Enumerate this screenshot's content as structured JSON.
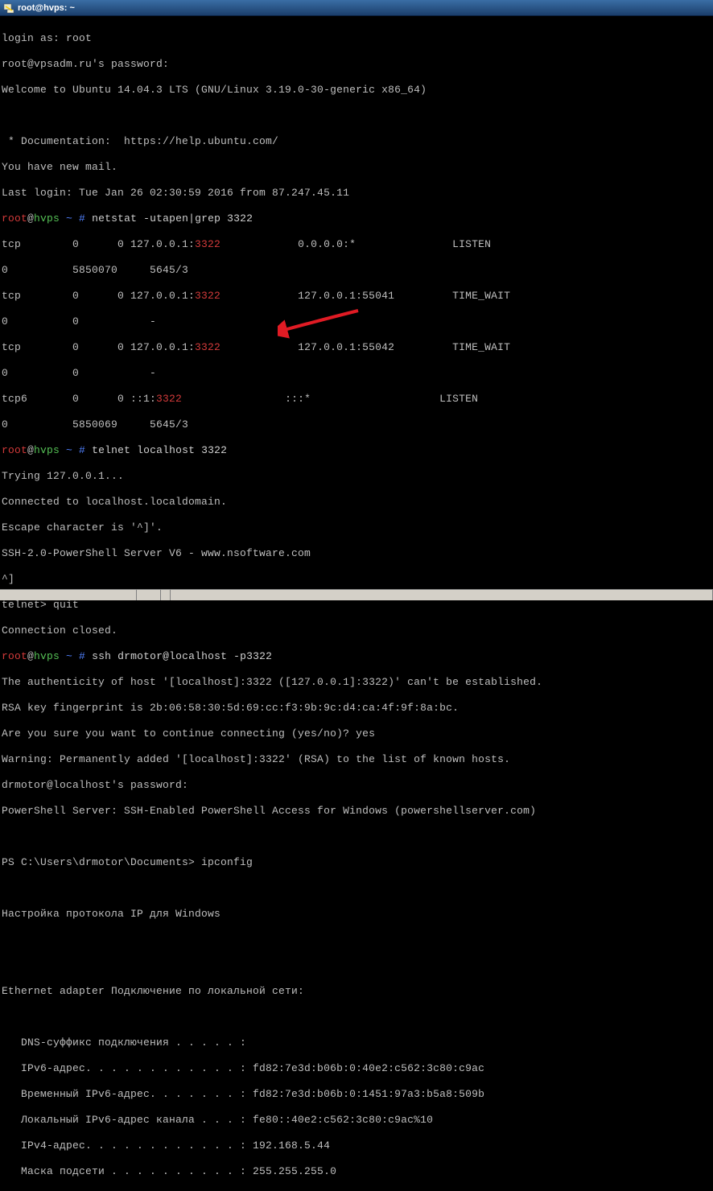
{
  "window": {
    "title": "root@hvps: ~",
    "icon_name": "putty-icon"
  },
  "prompt": {
    "user": "root",
    "at": "@",
    "host": "hvps",
    "path_sep": " ~ # "
  },
  "lines": {
    "login_as": "login as: root",
    "password_prompt": "root@vpsadm.ru's password:",
    "welcome": "Welcome to Ubuntu 14.04.3 LTS (GNU/Linux 3.19.0-30-generic x86_64)",
    "blank": "",
    "docs": " * Documentation:  https://help.ubuntu.com/",
    "mail": "You have new mail.",
    "last_login": "Last login: Tue Jan 26 02:30:59 2016 from 87.247.45.11",
    "cmd_netstat": "netstat -utapen|grep 3322",
    "ns_r1_a": "tcp        0      0 127.0.0.1:",
    "ns_r1_port": "3322",
    "ns_r1_b": "            0.0.0.0:*               LISTEN",
    "ns_r1_c": "0          5850070     5645/3",
    "ns_r2_a": "tcp        0      0 127.0.0.1:",
    "ns_r2_port": "3322",
    "ns_r2_b": "            127.0.0.1:55041         TIME_WAIT",
    "ns_r2_c": "0          0           -",
    "ns_r3_a": "tcp        0      0 127.0.0.1:",
    "ns_r3_port": "3322",
    "ns_r3_b": "            127.0.0.1:55042         TIME_WAIT",
    "ns_r3_c": "0          0           -",
    "ns_r4_a": "tcp6       0      0 ::1:",
    "ns_r4_port": "3322",
    "ns_r4_b": "                :::*                    LISTEN",
    "ns_r4_c": "0          5850069     5645/3",
    "cmd_telnet": "telnet localhost 3322",
    "trying": "Trying 127.0.0.1...",
    "connected": "Connected to localhost.localdomain.",
    "escape": "Escape character is '^]'.",
    "ssh_banner": "SSH-2.0-PowerShell Server V6 - www.nsoftware.com",
    "caret": "^]",
    "telnet_quit": "telnet> quit",
    "conn_closed": "Connection closed.",
    "cmd_ssh": "ssh drmotor@localhost -p3322",
    "auth_1": "The authenticity of host '[localhost]:3322 ([127.0.0.1]:3322)' can't be established.",
    "auth_2": "RSA key fingerprint is 2b:06:58:30:5d:69:cc:f3:9b:9c:d4:ca:4f:9f:8a:bc.",
    "auth_3": "Are you sure you want to continue connecting (yes/no)? yes",
    "auth_4": "Warning: Permanently added '[localhost]:3322' (RSA) to the list of known hosts.",
    "auth_5": "drmotor@localhost's password:",
    "ps_banner": "PowerShell Server: SSH-Enabled PowerShell Access for Windows (powershellserver.com)",
    "ps_prompt": "PS C:\\Users\\drmotor\\Documents> ipconfig",
    "ipcfg_title": "Настройка протокола IP для Windows",
    "eth_header": "Ethernet adapter Подключение по локальной сети:",
    "eth_1": "   DNS-суффикс подключения . . . . . :",
    "eth_2": "   IPv6-адрес. . . . . . . . . . . . : fd82:7e3d:b06b:0:40e2:c562:3c80:c9ac",
    "eth_3": "   Временный IPv6-адрес. . . . . . . : fd82:7e3d:b06b:0:1451:97a3:b5a8:509b",
    "eth_4": "   Локальный IPv6-адрес канала . . . : fe80::40e2:c562:3c80:c9ac%10",
    "eth_5": "   IPv4-адрес. . . . . . . . . . . . : 192.168.5.44",
    "eth_6": "   Маска подсети . . . . . . . . . . : 255.255.255.0"
  },
  "arrow": {
    "color": "#e01b24"
  }
}
